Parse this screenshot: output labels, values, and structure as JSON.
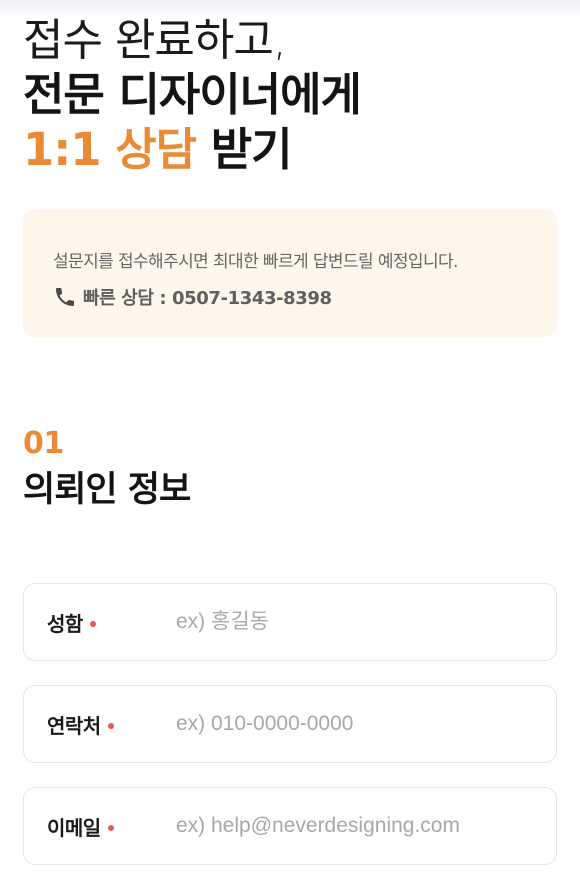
{
  "hero": {
    "line1": "접수 완료하고,",
    "line2": "전문 디자이너에게",
    "line3_accent": "1:1 상담",
    "line3_rest": " 받기"
  },
  "notice": {
    "description": "설문지를 접수해주시면 최대한 빠르게 답변드릴 예정입니다.",
    "phone_label": "빠른 상담 : 0507-1343-8398",
    "phone_icon": "phone-icon"
  },
  "section": {
    "number": "01",
    "title": "의뢰인 정보"
  },
  "form": {
    "fields": [
      {
        "label": "성함",
        "placeholder": "ex) 홍길동",
        "value": ""
      },
      {
        "label": "연락처",
        "placeholder": "ex) 010-0000-0000",
        "value": ""
      },
      {
        "label": "이메일",
        "placeholder": "ex) help@neverdesigning.com",
        "value": ""
      }
    ]
  },
  "colors": {
    "accent": "#e98a35",
    "notice_bg": "#fcf7ea",
    "required_dot": "#e0585a"
  }
}
